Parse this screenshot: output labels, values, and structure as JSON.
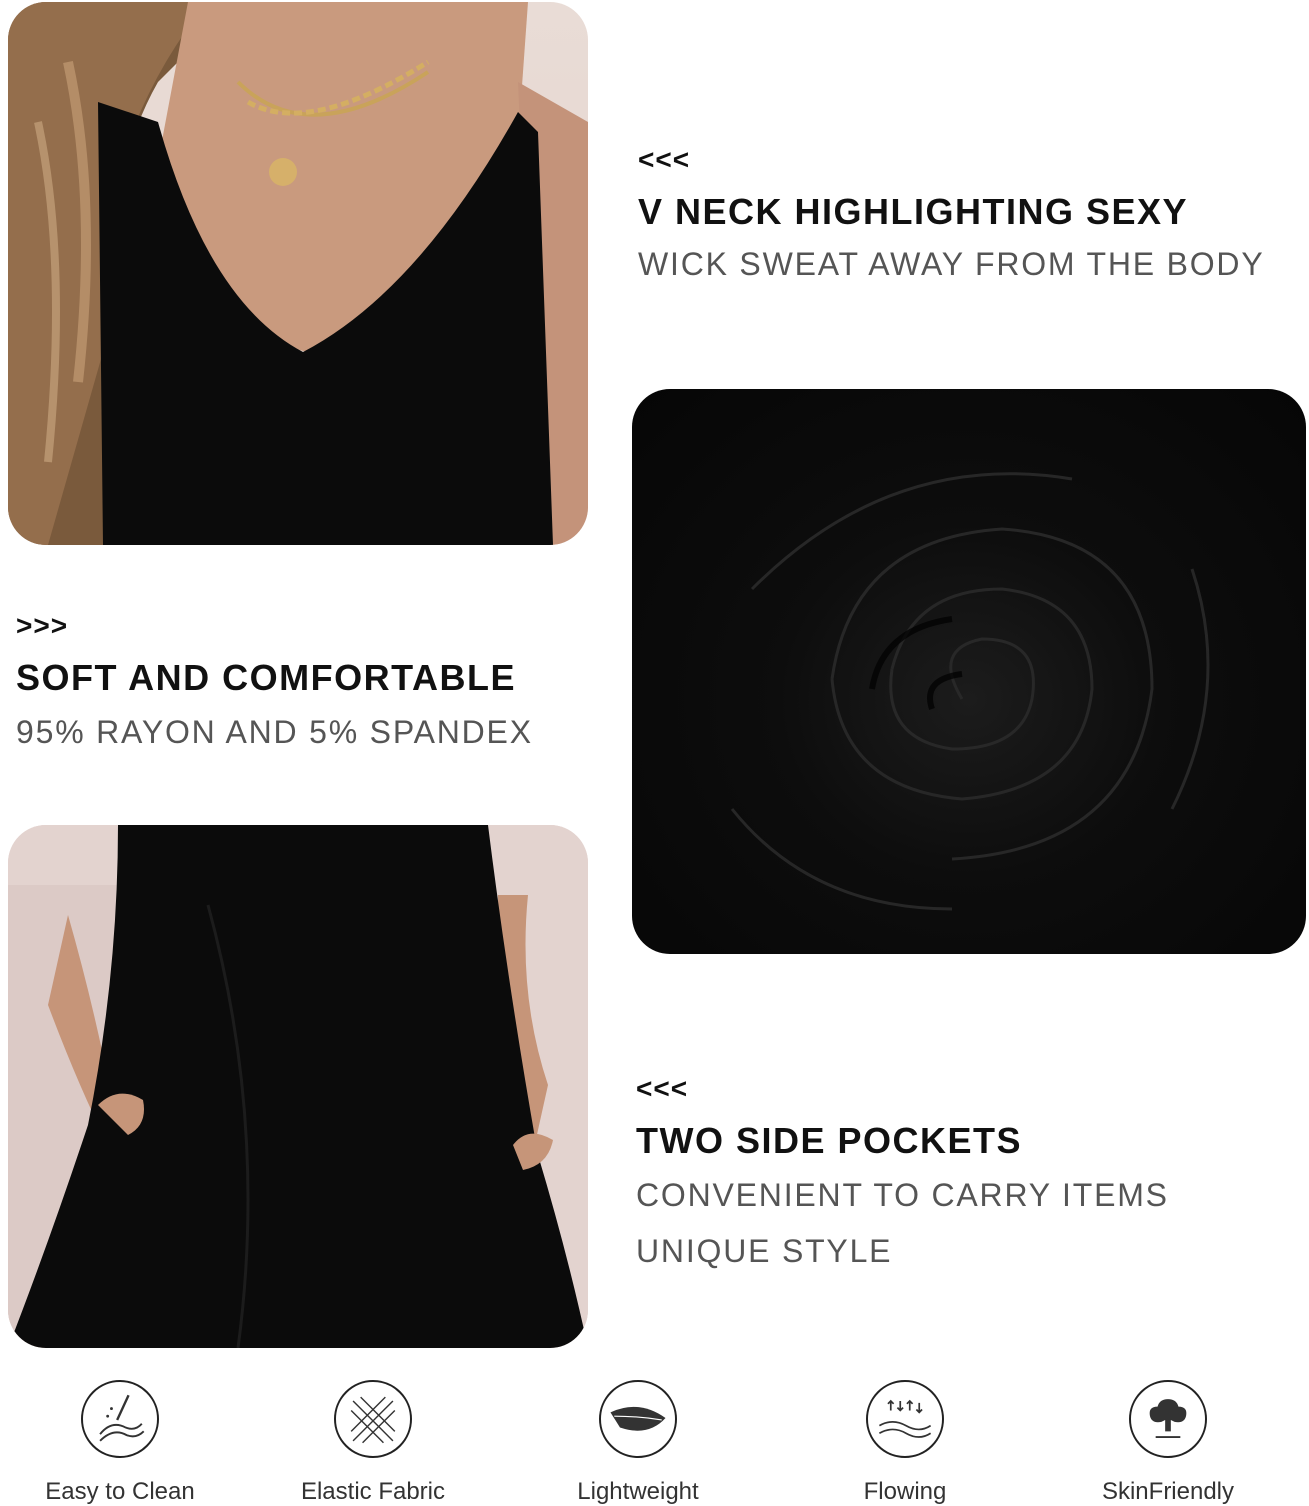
{
  "sections": {
    "vneck": {
      "arrows": "<<<",
      "heading": "V NECK HIGHLIGHTING SEXY",
      "sub": "WICK SWEAT AWAY FROM THE BODY"
    },
    "soft": {
      "arrows": ">>>",
      "heading": "SOFT AND COMFORTABLE",
      "sub": "95% RAYON AND 5% SPANDEX"
    },
    "pockets": {
      "arrows": "<<<",
      "heading": "TWO SIDE POCKETS",
      "sub1": "CONVENIENT TO CARRY ITEMS",
      "sub2": "UNIQUE STYLE"
    }
  },
  "features": [
    {
      "label": "Easy to Clean",
      "icon": "easy-clean-icon"
    },
    {
      "label": "Elastic Fabric",
      "icon": "elastic-fabric-icon"
    },
    {
      "label": "Lightweight",
      "icon": "feather-icon"
    },
    {
      "label": "Flowing",
      "icon": "flowing-icon"
    },
    {
      "label": "SkinFriendly",
      "icon": "tree-icon"
    }
  ],
  "colors": {
    "heading": "#111111",
    "subtext": "#555555",
    "dress": "#0b0b0b",
    "background_wall": "#e4d4cd"
  }
}
